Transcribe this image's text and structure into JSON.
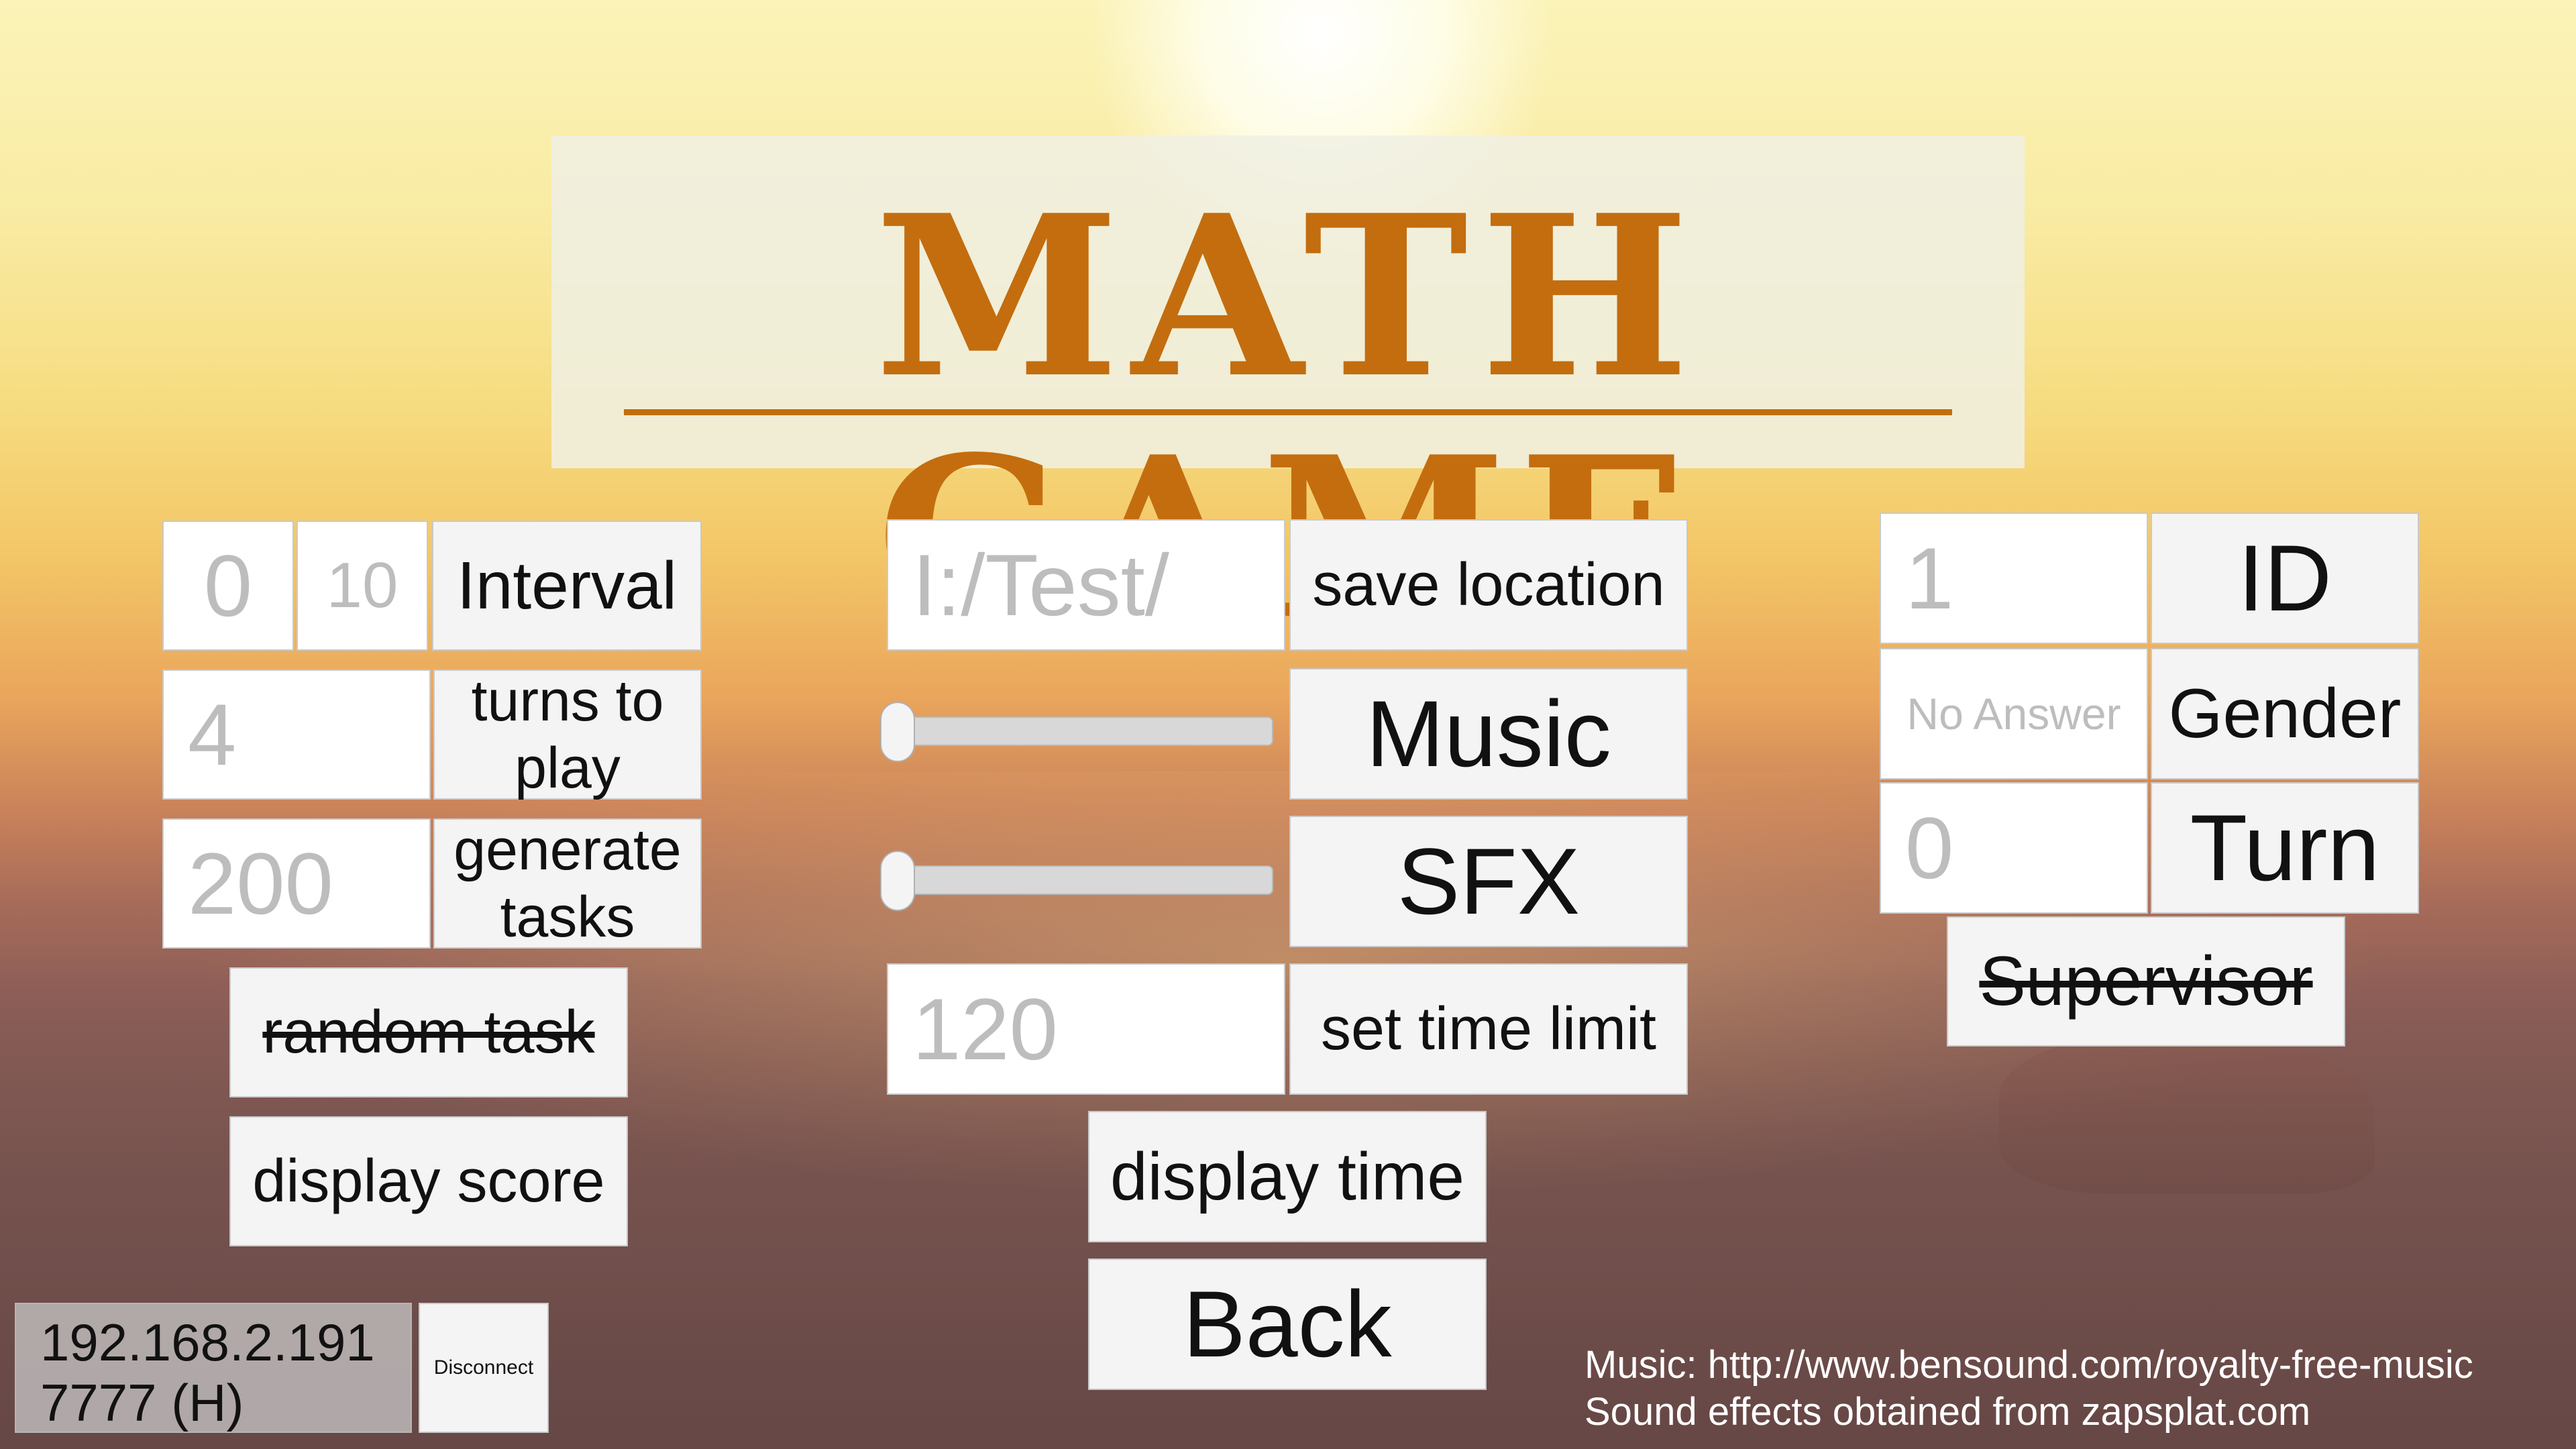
{
  "title": "MATH GAME",
  "left": {
    "interval_min": "0",
    "interval_max": "10",
    "interval_label": "Interval",
    "turns_value": "4",
    "turns_label": "turns to play",
    "tasks_value": "200",
    "tasks_label": "generate tasks",
    "random_task_label": "random task",
    "display_score_label": "display score"
  },
  "middle": {
    "save_path": "I:/Test/",
    "save_label": "save location",
    "music_label": "Music",
    "music_volume": 0,
    "sfx_label": "SFX",
    "sfx_volume": 0,
    "time_limit_value": "120",
    "time_limit_label": "set time limit",
    "display_time_label": "display time",
    "back_label": "Back"
  },
  "right": {
    "id_value": "1",
    "id_label": "ID",
    "gender_value": "No Answer",
    "gender_label": "Gender",
    "turn_value": "0",
    "turn_label": "Turn",
    "supervisor_label": "Supervisor"
  },
  "network": {
    "ip": "192.168.2.191",
    "port": "7777 (H)",
    "disconnect_label": "Disconnect"
  },
  "credits": {
    "music": "Music: http://www.bensound.com/royalty-free-music",
    "sfx": "Sound effects obtained from zapsplat.com"
  },
  "colors": {
    "title": "#c36d0f",
    "button_bg": "#f4f4f4",
    "placeholder_text": "#bdbdbd"
  }
}
